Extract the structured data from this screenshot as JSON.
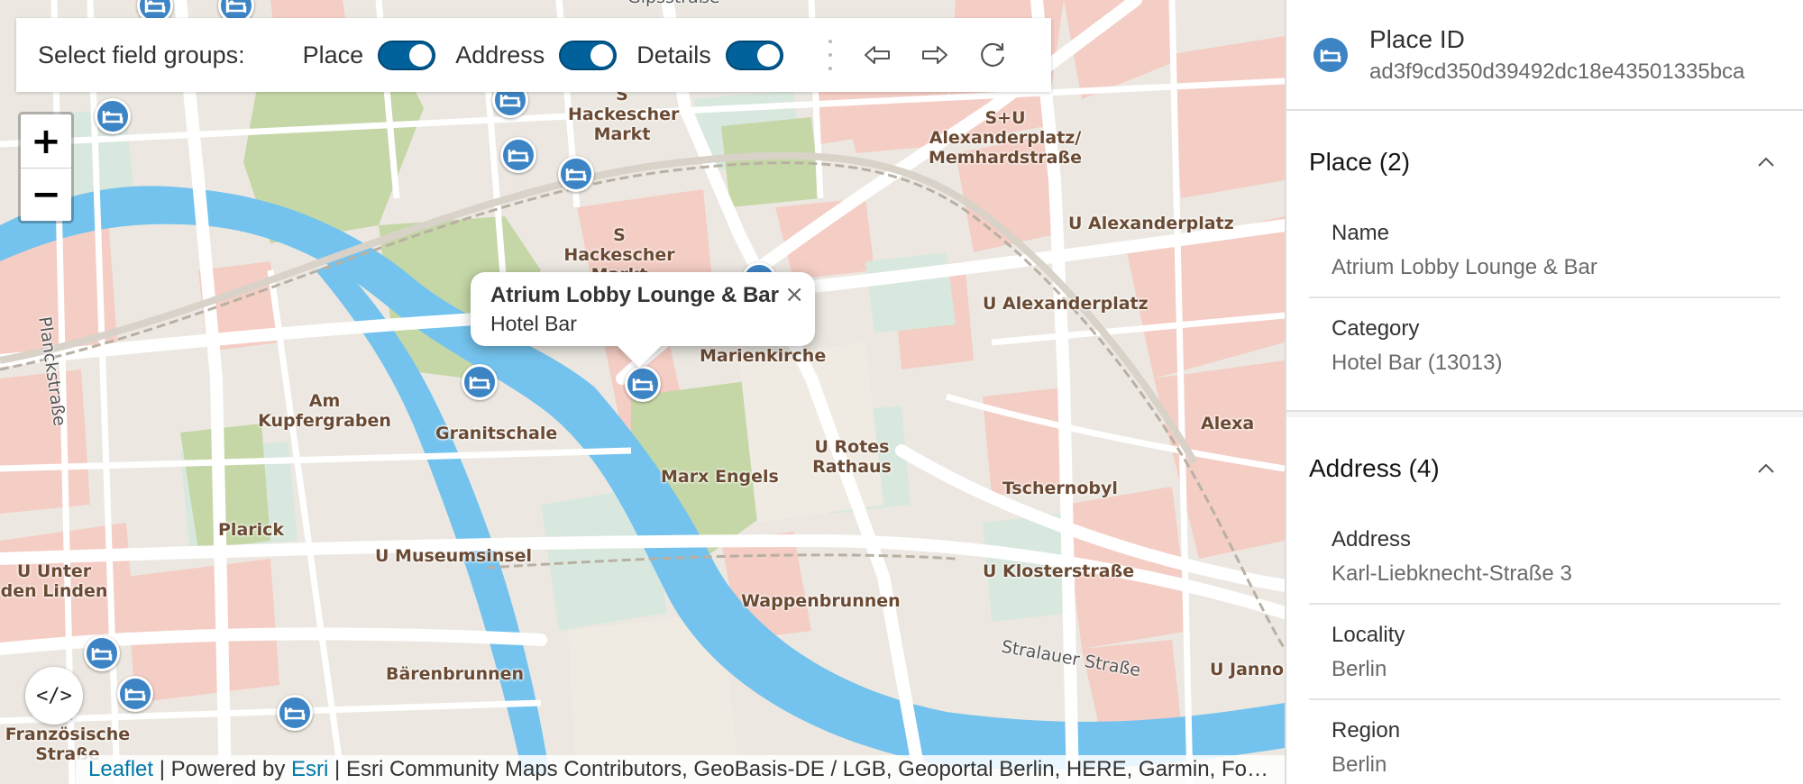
{
  "toolbar": {
    "label": "Select field groups:",
    "groups": [
      {
        "label": "Place",
        "on": true
      },
      {
        "label": "Address",
        "on": true
      },
      {
        "label": "Details",
        "on": true
      }
    ],
    "buttons": [
      "back-arrow-icon",
      "forward-arrow-icon",
      "refresh-icon"
    ]
  },
  "zoom": {
    "in": "+",
    "out": "−"
  },
  "popup": {
    "title": "Atrium Lobby Lounge & Bar",
    "subtitle": "Hotel Bar",
    "close": "×"
  },
  "code_button": "</>",
  "map_labels": [
    "S Hackescher Markt",
    "S Hackescher Markt",
    "S+U Alexanderplatz/ Memhardstraße",
    "U Alexanderplatz",
    "U Alexanderplatz",
    "Marienkirche",
    "Am Kupfergraben",
    "Granitschale",
    "Marx Engels",
    "U Rotes Rathaus",
    "Alexa",
    "Tschernobyl",
    "Plarick",
    "U Museumsinsel",
    "U Unter den Linden",
    "U Klosterstraße",
    "Wappenbrunnen",
    "Bärenbrunnen",
    "U Französische Straße",
    "Planckstraße",
    "Stralauer Straße",
    "U Jannowitzbrücke",
    "Gipsstraße"
  ],
  "attribution": {
    "leaflet": "Leaflet",
    "sep1": " | Powered by ",
    "esri": "Esri",
    "rest": " | Esri Community Maps Contributors, GeoBasis-DE / LGB, Geoportal Berlin, HERE, Garmin, Fo…"
  },
  "sidebar": {
    "place_id": {
      "label": "Place ID",
      "value": "ad3f9cd350d39492dc18e43501335bca"
    },
    "sections": [
      {
        "title": "Place (2)",
        "fields": [
          {
            "key": "Name",
            "value": "Atrium Lobby Lounge & Bar"
          },
          {
            "key": "Category",
            "value": "Hotel Bar (13013)"
          }
        ]
      },
      {
        "title": "Address (4)",
        "fields": [
          {
            "key": "Address",
            "value": "Karl-Liebknecht-Straße 3"
          },
          {
            "key": "Locality",
            "value": "Berlin"
          },
          {
            "key": "Region",
            "value": "Berlin"
          }
        ]
      }
    ]
  },
  "colors": {
    "marker": "#3d84c5",
    "toggle": "#00619b",
    "water": "#74c3ee",
    "park": "#c5d7a6",
    "building_pink": "#f4cdc4",
    "road": "#ffffff"
  }
}
